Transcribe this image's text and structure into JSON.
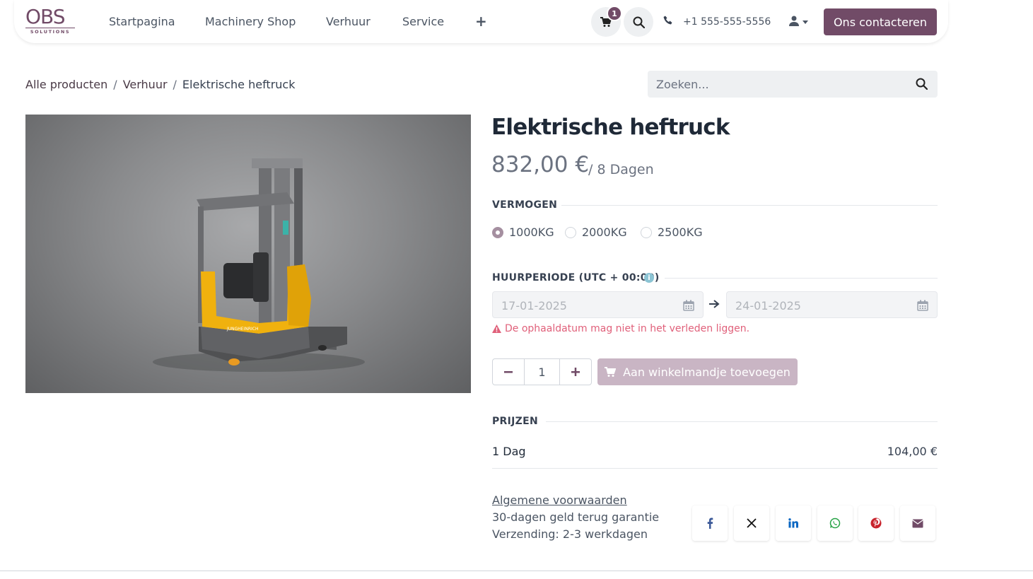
{
  "nav": {
    "logo_main": "OBS",
    "logo_sub": "SOLUTIONS",
    "items": [
      "Startpagina",
      "Machinery Shop",
      "Verhuur",
      "Service"
    ],
    "plus_label": "+",
    "cart_count": "1",
    "phone": "+1 555-555-5556",
    "contact_label": "Ons contacteren"
  },
  "breadcrumb": {
    "items": [
      "Alle producten",
      "Verhuur",
      "Elektrische heftruck"
    ],
    "separator": "/"
  },
  "search": {
    "placeholder": "Zoeken..."
  },
  "product": {
    "title": "Elektrische heftruck",
    "price": "832,00 €",
    "price_unit": "/ 8 Dagen"
  },
  "capacity": {
    "label": "VERMOGEN",
    "options": [
      "1000KG",
      "2000KG",
      "2500KG"
    ],
    "selected": "1000KG"
  },
  "rental": {
    "label": "HUURPERIODE (UTC + 00:00)",
    "start_date": "17-01-2025",
    "end_date": "24-01-2025",
    "error": "De ophaaldatum mag niet in het verleden liggen."
  },
  "cart": {
    "quantity": "1",
    "add_label": "Aan winkelmandje toevoegen"
  },
  "pricing": {
    "label": "PRIJZEN",
    "rows": [
      {
        "period": "1 Dag",
        "price": "104,00 €"
      }
    ]
  },
  "extra": {
    "terms": "Algemene voorwaarden",
    "guarantee": "30-dagen geld terug garantie",
    "shipping": "Verzending: 2-3 werkdagen"
  },
  "share": [
    "facebook-icon",
    "x-icon",
    "linkedin-icon",
    "whatsapp-icon",
    "pinterest-icon",
    "envelope-icon"
  ],
  "colors": {
    "brand": "#714B67",
    "brand_light": "#c9b5c4",
    "error": "#e0607a"
  }
}
